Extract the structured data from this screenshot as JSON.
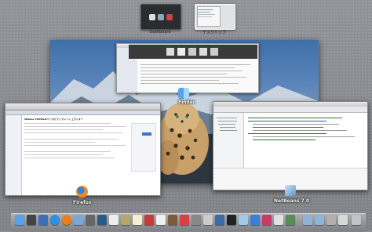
{
  "spaces": {
    "dashboard_label": "Dashboard",
    "desktop_label": "デスクトップ"
  },
  "windows": {
    "finder_label": "Finder",
    "firefox_label": "Firefox",
    "netbeans_label": "NetBeans 7.0"
  },
  "firefox_page": {
    "heading": "Weblue PHPWebページの テンプレート エディター"
  },
  "colors": {
    "accent_blue": "#3d74c8",
    "leopard_fur": "#c8a06a",
    "dock_bg": "#9c9ea4"
  },
  "dock": {
    "icons": [
      "finder-icon",
      "dashboard-icon",
      "mission-control-icon",
      "safari-icon",
      "firefox-icon",
      "mail-icon",
      "facetime-icon",
      "address-book-icon",
      "calendar-icon",
      "notes-icon",
      "photo-icon",
      "itunes-icon",
      "system-preferences-icon",
      "netbeans-icon",
      "app-icon",
      "app-icon",
      "app-icon",
      "app-icon",
      "folder-icon",
      "folder-icon",
      "trash-icon"
    ]
  }
}
